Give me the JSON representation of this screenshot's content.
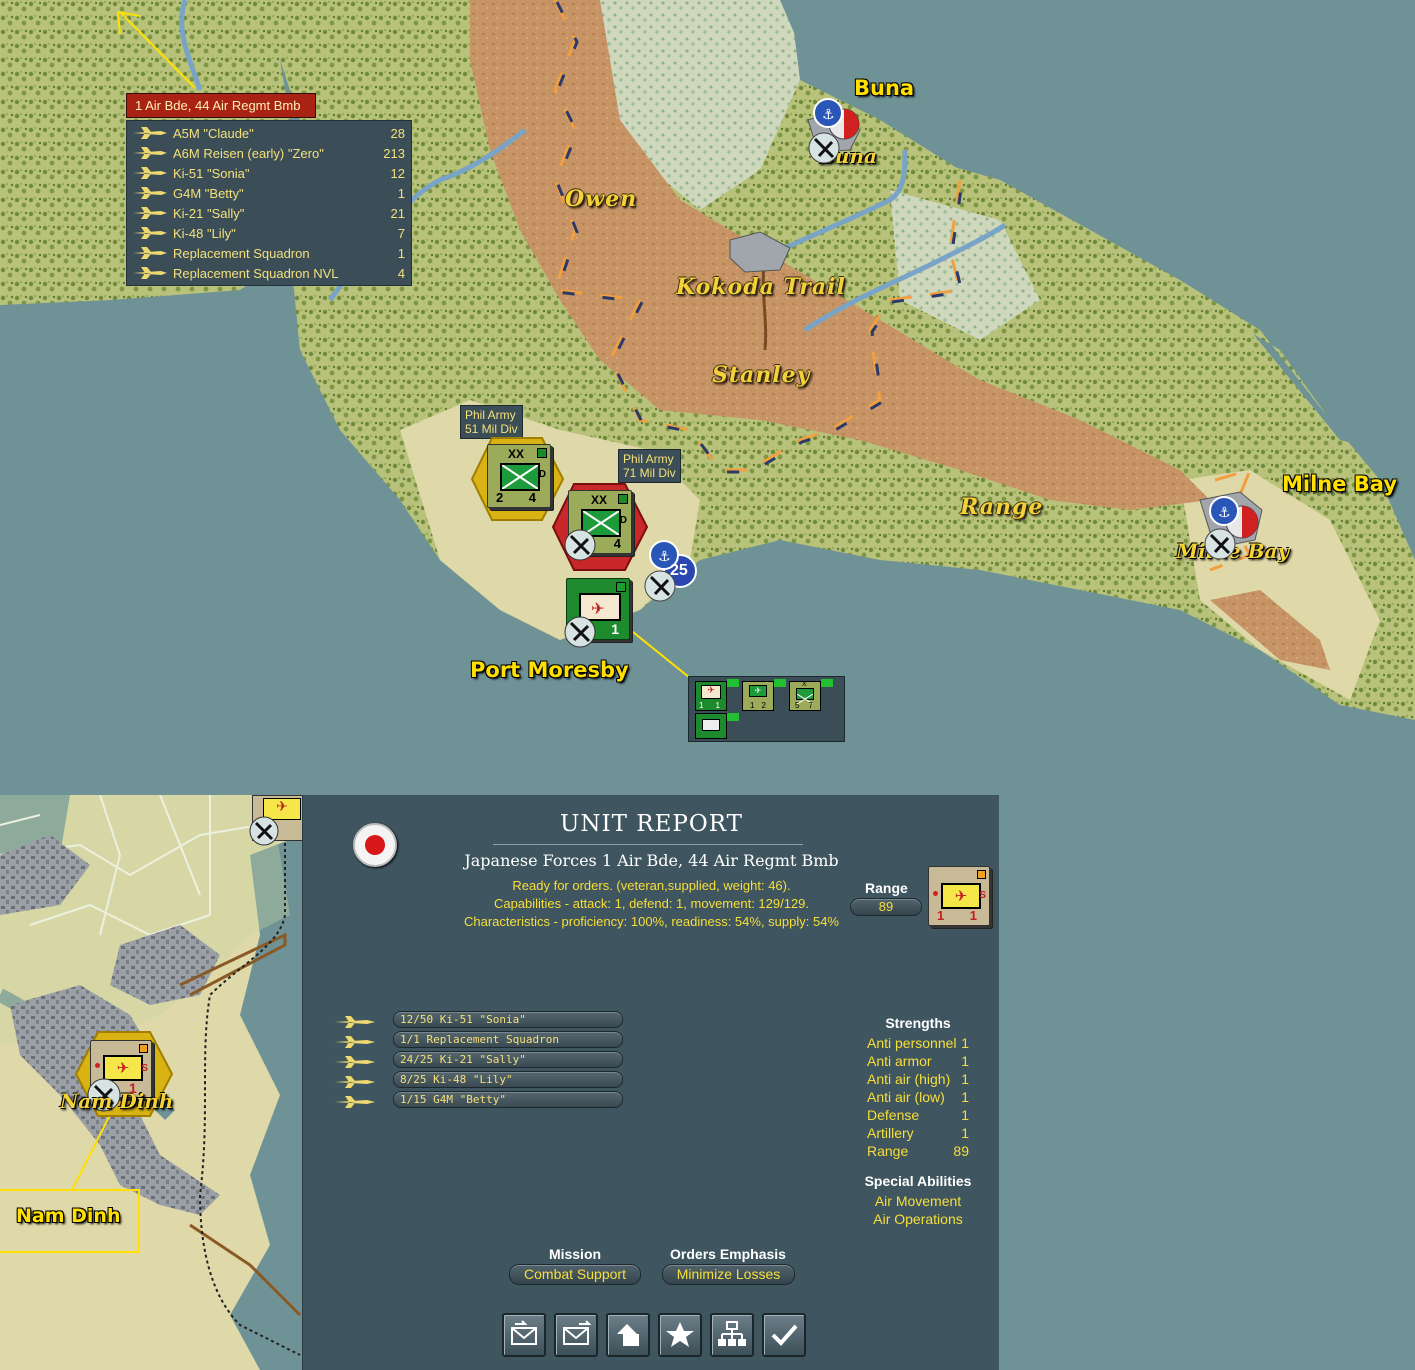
{
  "map": {
    "terrain_labels": [
      "Owen",
      "Kokoda Trail",
      "Stanley",
      "Range"
    ],
    "places": {
      "buna": "Buna",
      "buna_town": "Buna",
      "milne_bay": "Milne Bay",
      "milne_bay_town": "Milne Bay",
      "port_moresby": "Port Moresby",
      "nam_dinh": "Nam Dinh",
      "nam_dinh_town": "Nam Dinh"
    },
    "unit_tags": {
      "phil51": "Phil Army\n51 Mil Div",
      "phil71": "Phil Army\n71 Mil Div"
    },
    "counters": {
      "phil51": {
        "size": "XX",
        "attack": "2",
        "defend": "4",
        "type": "D"
      },
      "phil71": {
        "size": "XX",
        "attack": "",
        "defend": "4",
        "type": "D"
      },
      "moresby_air": {
        "value": "1"
      },
      "port_number": "25",
      "nam_dinh_air": {
        "attack": "1",
        "type": "S"
      }
    },
    "stack_popup": {
      "units": [
        {
          "a": "1",
          "b": "1"
        },
        {
          "a": "1",
          "b": "2"
        },
        {
          "a": "5",
          "b": "7",
          "size": "X"
        }
      ]
    }
  },
  "air_popup": {
    "header": "1 Air Bde, 44 Air Regmt Bmb",
    "rows": [
      {
        "name": "A5M \"Claude\"",
        "count": "28"
      },
      {
        "name": "A6M Reisen (early) \"Zero\"",
        "count": "213"
      },
      {
        "name": "Ki-51 \"Sonia\"",
        "count": "12"
      },
      {
        "name": "G4M \"Betty\"",
        "count": "1"
      },
      {
        "name": "Ki-21 \"Sally\"",
        "count": "21"
      },
      {
        "name": "Ki-48 \"Lily\"",
        "count": "7"
      },
      {
        "name": "Replacement Squadron",
        "count": "1"
      },
      {
        "name": "Replacement Squadron NVL",
        "count": "4"
      }
    ]
  },
  "report": {
    "title": "UNIT REPORT",
    "subtitle": "Japanese Forces 1 Air Bde, 44 Air Regmt Bmb",
    "status": "Ready for orders. (veteran,supplied, weight: 46).",
    "capabilities": "Capabilities - attack: 1, defend: 1, movement: 129/129.",
    "characteristics": "Characteristics - proficiency: 100%, readiness: 54%, supply: 54%",
    "range_label": "Range",
    "range_value": "89",
    "counter": {
      "attack": "1",
      "defend": "1",
      "type": "S"
    },
    "squadrons": [
      "12/50 Ki-51 \"Sonia\"",
      "1/1 Replacement Squadron",
      "24/25 Ki-21 \"Sally\"",
      "8/25 Ki-48 \"Lily\"",
      "1/15 G4M \"Betty\""
    ],
    "strengths_title": "Strengths",
    "strengths": [
      {
        "label": "Anti personnel",
        "value": "1"
      },
      {
        "label": "Anti armor",
        "value": "1"
      },
      {
        "label": "Anti air (high)",
        "value": "1"
      },
      {
        "label": "Anti air (low)",
        "value": "1"
      },
      {
        "label": "Defense",
        "value": "1"
      },
      {
        "label": "Artillery",
        "value": "1"
      },
      {
        "label": "Range",
        "value": "89"
      }
    ],
    "special_title": "Special Abilities",
    "special": [
      "Air Movement",
      "Air Operations"
    ],
    "mission_label": "Mission",
    "mission_value": "Combat Support",
    "emphasis_label": "Orders Emphasis",
    "emphasis_value": "Minimize Losses",
    "buttons": [
      "mail-out-icon",
      "mail-send-icon",
      "unit-shape-icon",
      "star-icon",
      "org-chart-icon",
      "checkmark-icon"
    ]
  },
  "colors": {
    "sea": "#6f9297",
    "panel": "#3f555f",
    "label_yellow": "#ffe000",
    "text_gold": "#f7df3a",
    "header_red": "#a82314"
  }
}
